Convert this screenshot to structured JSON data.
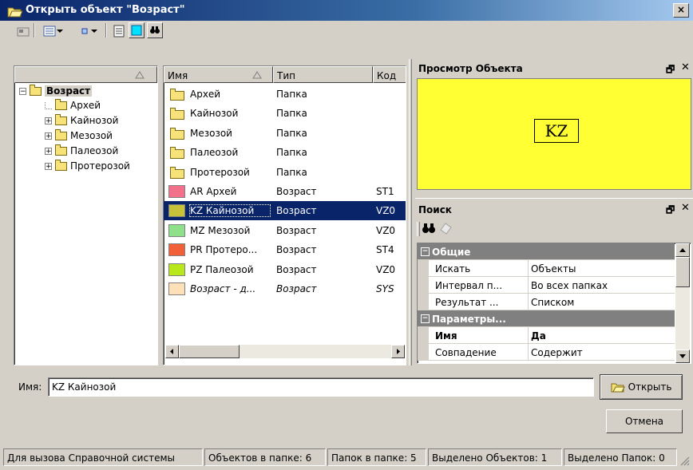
{
  "window": {
    "title": "Открыть объект \"Возраст\"",
    "close_glyph": "×"
  },
  "tree": {
    "root": "Возраст",
    "items": [
      "Архей",
      "Кайнозой",
      "Мезозой",
      "Палеозой",
      "Протерозой"
    ]
  },
  "list": {
    "columns": [
      "Имя",
      "Тип",
      "Код"
    ],
    "rows": [
      {
        "name": "Архей",
        "type": "Папка",
        "code": "",
        "kind": "folder"
      },
      {
        "name": "Кайнозой",
        "type": "Папка",
        "code": "",
        "kind": "folder"
      },
      {
        "name": "Мезозой",
        "type": "Папка",
        "code": "",
        "kind": "folder"
      },
      {
        "name": "Палеозой",
        "type": "Папка",
        "code": "",
        "kind": "folder"
      },
      {
        "name": "Протерозой",
        "type": "Папка",
        "code": "",
        "kind": "folder"
      },
      {
        "name": "AR Архей",
        "type": "Возраст",
        "code": "ST1",
        "kind": "item",
        "color": "#f2708a"
      },
      {
        "name": "KZ Кайнозой",
        "type": "Возраст",
        "code": "VZ0",
        "kind": "item",
        "color": "#c8c23a",
        "selected": true
      },
      {
        "name": "MZ Мезозой",
        "type": "Возраст",
        "code": "VZ0",
        "kind": "item",
        "color": "#8ee08a"
      },
      {
        "name": "PR Протеро...",
        "type": "Возраст",
        "code": "ST4",
        "kind": "item",
        "color": "#f2603a"
      },
      {
        "name": "PZ Палеозой",
        "type": "Возраст",
        "code": "VZ0",
        "kind": "item",
        "color": "#b8e81a"
      },
      {
        "name": "Возраст - д...",
        "type": "Возраст",
        "code": "SYS",
        "kind": "item",
        "color": "#fde0b8",
        "italic": true
      }
    ]
  },
  "preview": {
    "title": "Просмотр Объекта",
    "label": "KZ",
    "background": "#ffff33"
  },
  "search": {
    "title": "Поиск",
    "groups": [
      {
        "category": "Общие",
        "props": [
          {
            "key": "Искать",
            "value": "Объекты"
          },
          {
            "key": "Интервал п...",
            "value": "Во всех папках"
          },
          {
            "key": "Результат ...",
            "value": "Списком"
          }
        ]
      },
      {
        "category": "Параметры...",
        "props": [
          {
            "key": "Имя",
            "value": "Да",
            "bold": true
          },
          {
            "key": "Совпадение",
            "value": "Содержит"
          }
        ]
      }
    ]
  },
  "name_field": {
    "label": "Имя:",
    "value": "KZ Кайнозой"
  },
  "buttons": {
    "open": "Открыть",
    "cancel": "Отмена"
  },
  "status": [
    "Для вызова Справочной системы",
    "Объектов в папке: 6",
    "Папок в папке: 5",
    "Выделено Объектов: 1",
    "Выделено Папок: 0"
  ],
  "colors": {
    "accent": "#0a246a",
    "face": "#d4d0c8"
  }
}
